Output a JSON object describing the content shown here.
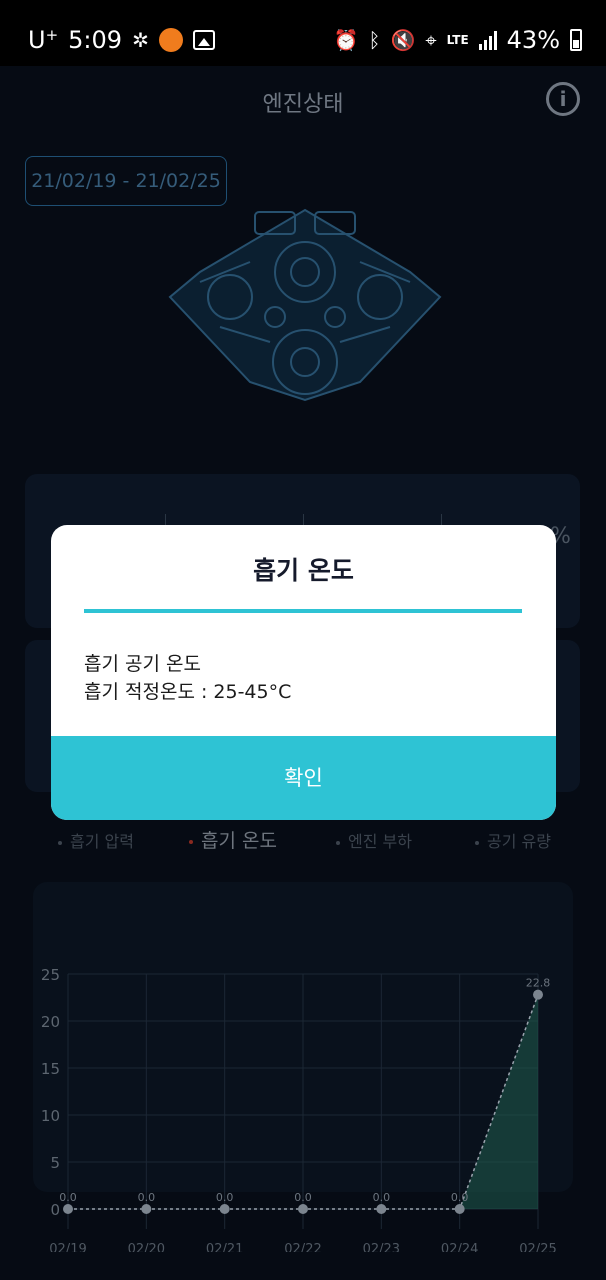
{
  "status_bar": {
    "carrier": "U",
    "carrier_sup": "+",
    "time": "5:09",
    "network": "LTE",
    "battery": "43%"
  },
  "header": {
    "title": "엔진상태",
    "info_icon": "info-icon"
  },
  "date_range": "21/02/19 - 21/02/25",
  "stat_unit": "%",
  "tabs": [
    {
      "label": "흡기 압력",
      "active": false
    },
    {
      "label": "흡기 온도",
      "active": true
    },
    {
      "label": "엔진 부하",
      "active": false
    },
    {
      "label": "공기 유량",
      "active": false
    }
  ],
  "modal": {
    "title": "흡기 온도",
    "line1": "흡기 공기 온도",
    "line2": "흡기 적정온도 : 25-45°C",
    "confirm": "확인"
  },
  "chart_data": {
    "type": "area",
    "categories": [
      "02/19",
      "02/20",
      "02/21",
      "02/22",
      "02/23",
      "02/24",
      "02/25"
    ],
    "values": [
      0.0,
      0.0,
      0.0,
      0.0,
      0.0,
      0.0,
      22.8
    ],
    "value_labels": [
      "0.0",
      "0.0",
      "0.0",
      "0.0",
      "0.0",
      "0.0",
      "22.8"
    ],
    "y_ticks": [
      0,
      5,
      10,
      15,
      20,
      25
    ],
    "ylim": [
      0,
      25
    ],
    "grid": true,
    "colors": {
      "line": "#9aa3ad",
      "fill": "#1f5c4f",
      "grid": "#1c2734"
    }
  }
}
